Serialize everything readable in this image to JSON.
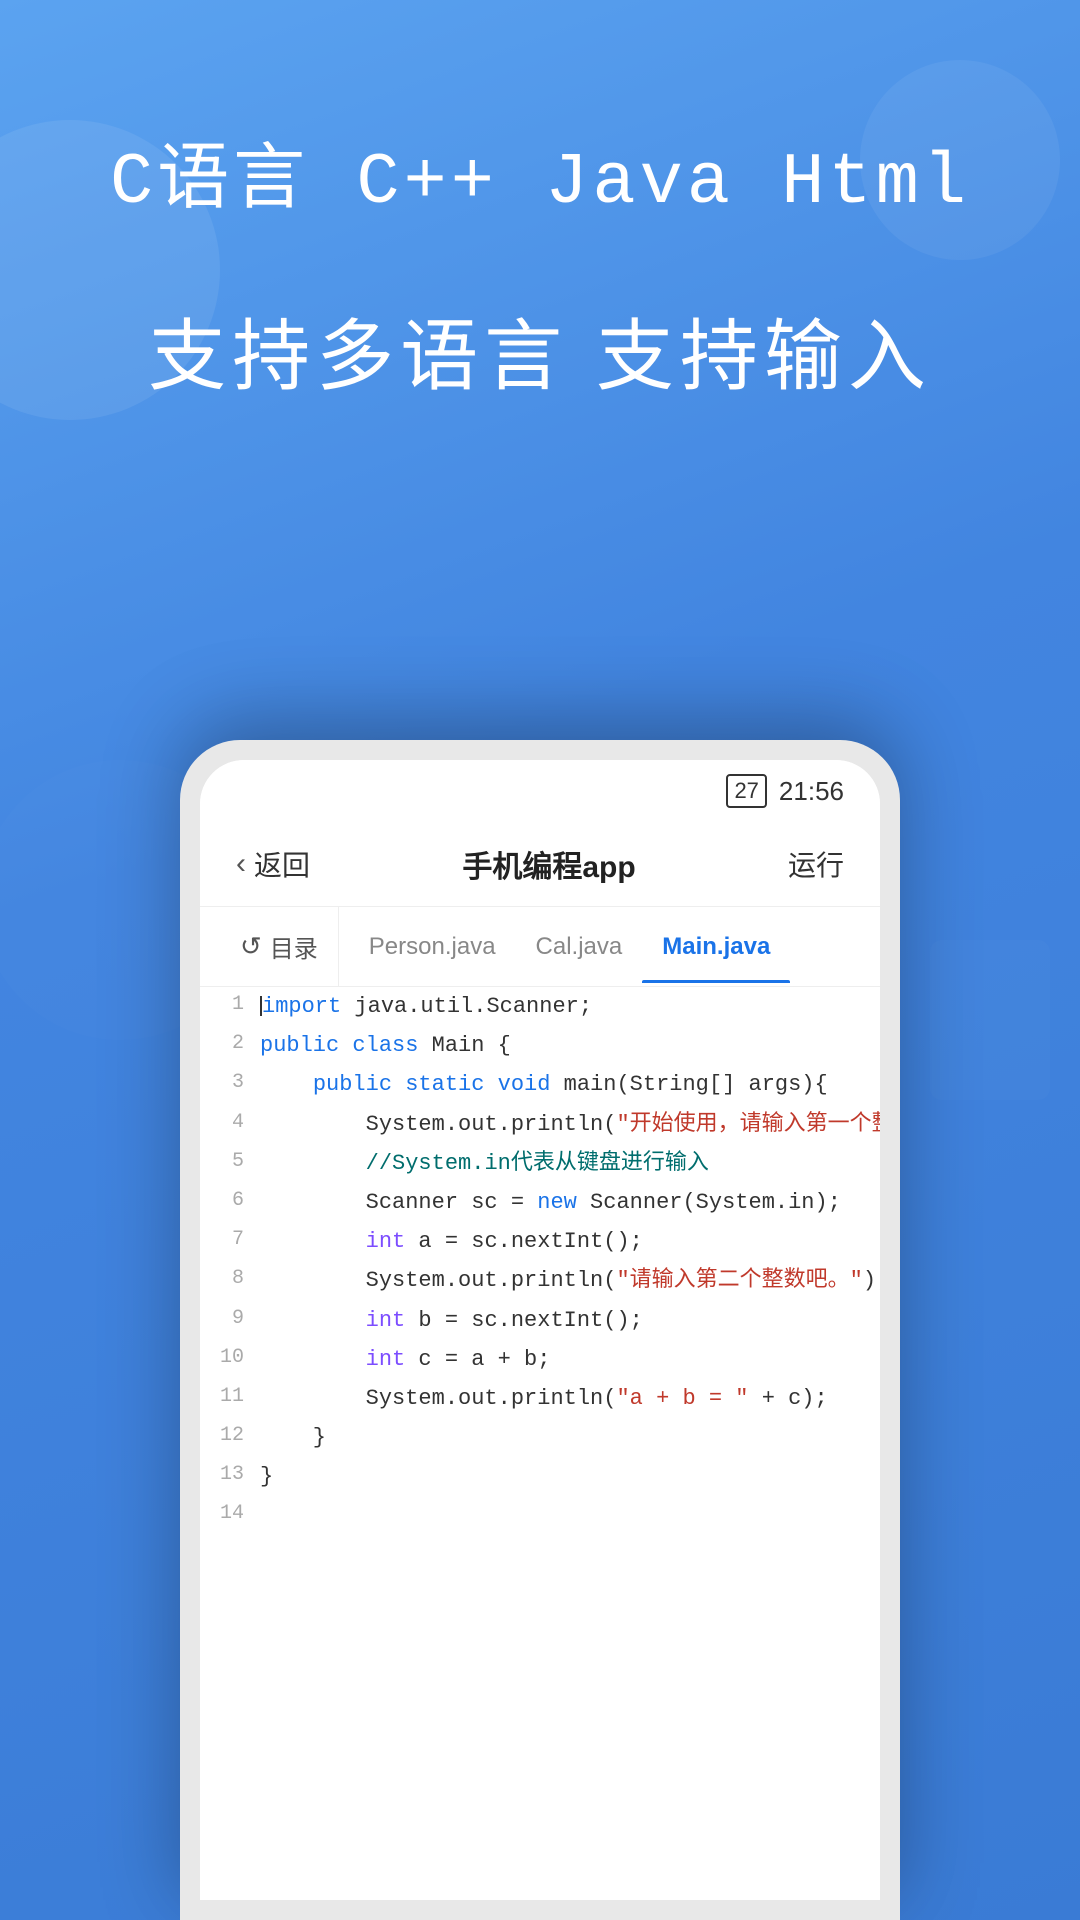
{
  "background": {
    "color": "#4a90e2"
  },
  "hero": {
    "title": "C语言  C++  Java  Html",
    "subtitle": "支持多语言 支持输入"
  },
  "status_bar": {
    "battery": "27",
    "time": "21:56"
  },
  "app_header": {
    "back_label": "返回",
    "title": "手机编程app",
    "run_label": "运行"
  },
  "tabs": {
    "folder_label": "目录",
    "items": [
      {
        "label": "Person.java",
        "active": false
      },
      {
        "label": "Cal.java",
        "active": false
      },
      {
        "label": "Main.java",
        "active": true
      }
    ]
  },
  "code": {
    "lines": [
      {
        "num": "1",
        "content": "import java.util.Scanner;"
      },
      {
        "num": "2",
        "content": "public class Main {"
      },
      {
        "num": "3",
        "content": "    public static void main(String[] args){"
      },
      {
        "num": "4",
        "content": "        System.out.println(\"开始使用，请输入第一个整数吧。\");"
      },
      {
        "num": "5",
        "content": "        //System.in代表从键盘进行输入"
      },
      {
        "num": "6",
        "content": "        Scanner sc = new Scanner(System.in);"
      },
      {
        "num": "7",
        "content": "        int a = sc.nextInt();"
      },
      {
        "num": "8",
        "content": "        System.out.println(\"请输入第二个整数吧。\");"
      },
      {
        "num": "9",
        "content": "        int b = sc.nextInt();"
      },
      {
        "num": "10",
        "content": "        int c = a + b;"
      },
      {
        "num": "11",
        "content": "        System.out.println(\"a + b = \" + c);"
      },
      {
        "num": "12",
        "content": "    }"
      },
      {
        "num": "13",
        "content": "}"
      },
      {
        "num": "14",
        "content": ""
      }
    ]
  }
}
